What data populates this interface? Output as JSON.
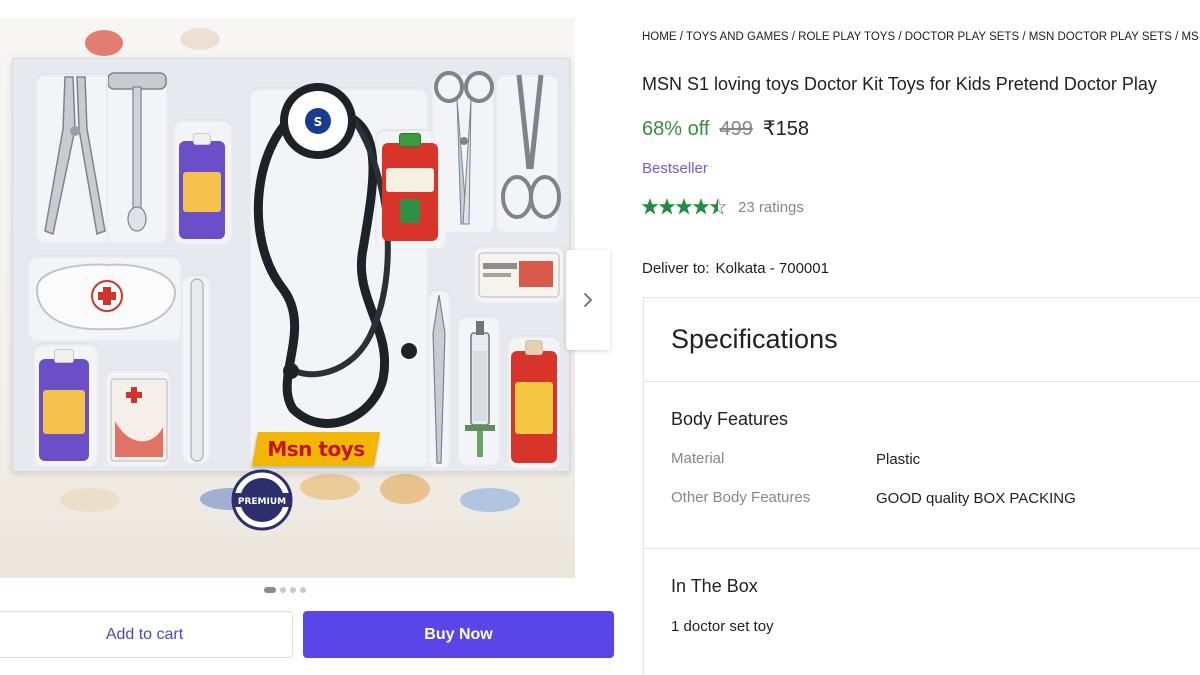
{
  "product": {
    "breadcrumb": [
      "HOME",
      "TOYS AND GAMES",
      "ROLE PLAY TOYS",
      "DOCTOR PLAY SETS",
      "MSN DOCTOR PLAY SETS",
      "MS"
    ],
    "title": "MSN S1 loving toys Doctor Kit Toys for Kids Pretend Doctor Play",
    "discount": "68% off",
    "mrp": "499",
    "price": "₹158",
    "badge": "Bestseller",
    "rating_stars": 4.5,
    "ratings_count": "23 ratings",
    "deliver_label": "Deliver to:",
    "deliver_location": "Kolkata - 700001"
  },
  "gallery": {
    "brand_label": "Msn toys",
    "seal_text": "PREMIUM",
    "dots": 4,
    "active_dot": 1,
    "next_icon": "chevron-right-icon"
  },
  "actions": {
    "add_to_cart": "Add to cart",
    "buy_now": "Buy Now"
  },
  "specifications": {
    "heading": "Specifications",
    "body_features": {
      "title": "Body Features",
      "rows": [
        {
          "key": "Material",
          "value": "Plastic"
        },
        {
          "key": "Other Body Features",
          "value": "GOOD quality BOX PACKING"
        }
      ]
    },
    "in_the_box": {
      "title": "In The Box",
      "items": [
        "1 doctor set toy"
      ]
    }
  },
  "colors": {
    "discount_green": "#388e3c",
    "bestseller_purple": "#7b5bc7",
    "star_green": "#1f8f3f",
    "buy_button": "#5a45e8",
    "cart_text": "#4a4ac4"
  }
}
